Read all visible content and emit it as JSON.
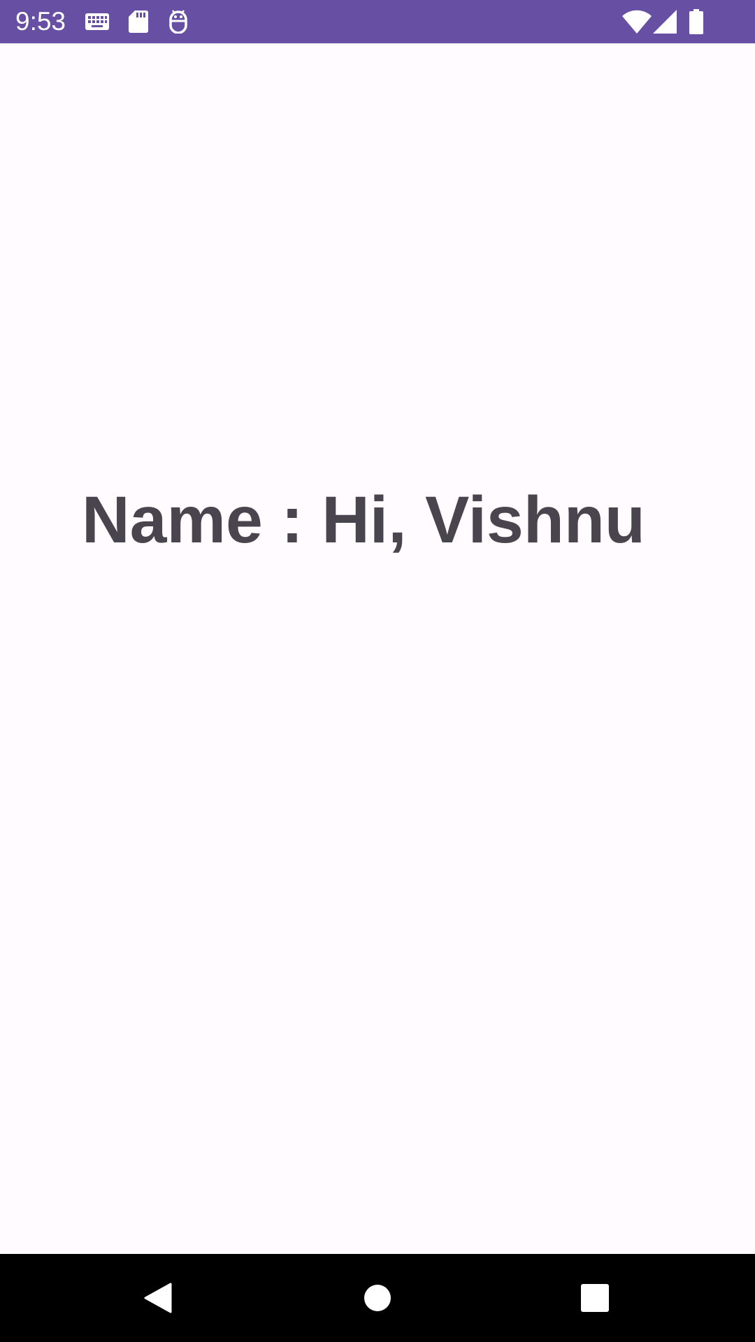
{
  "status_bar": {
    "time": "9:53",
    "background_color": "#6750a4",
    "left_icons": [
      "keyboard-icon",
      "sd-card-icon",
      "android-debug-icon"
    ],
    "right_icons": [
      "wifi-icon",
      "cell-signal-icon",
      "battery-icon"
    ]
  },
  "main": {
    "name_text": "Name : Hi, Vishnu",
    "text_color": "#49454f",
    "background_color": "#fffbfe"
  },
  "nav_bar": {
    "buttons": [
      "back-icon",
      "home-icon",
      "recents-icon"
    ]
  }
}
